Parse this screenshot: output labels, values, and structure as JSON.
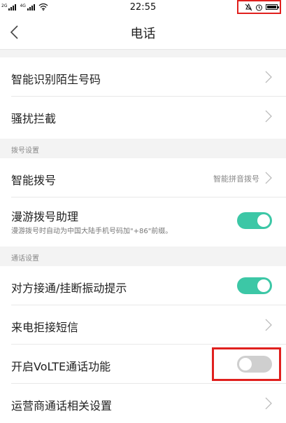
{
  "status_bar": {
    "sim1_tag": "2G",
    "sim2_tag": "4G",
    "time": "22:55",
    "icons": [
      "signal-icon",
      "signal-icon",
      "wifi-icon",
      "mute-icon",
      "alarm-icon",
      "battery-icon"
    ]
  },
  "header": {
    "title": "电话",
    "back_icon": "chevron-left-icon"
  },
  "sections": {
    "top": {
      "items": [
        {
          "label": "智能识别陌生号码"
        },
        {
          "label": "骚扰拦截"
        }
      ]
    },
    "dial_settings": {
      "header": "拨号设置",
      "smart_dial": {
        "label": "智能拨号",
        "value": "智能拼音拨号"
      },
      "roaming": {
        "label": "漫游拨号助理",
        "sub": "漫游拨号时自动为中国大陆手机号码加\"+86\"前缀。",
        "toggle": "on"
      }
    },
    "call_settings": {
      "header": "通话设置",
      "vibrate": {
        "label": "对方接通/挂断振动提示",
        "toggle": "on"
      },
      "reject_sms": {
        "label": "来电拒接短信"
      },
      "volte": {
        "label": "开启VoLTE通话功能",
        "toggle": "off"
      },
      "carrier": {
        "label": "运营商通话相关设置"
      }
    }
  },
  "colors": {
    "toggle_on": "#3cc7a6",
    "toggle_off": "#cfcfcf",
    "highlight": "#e0201e",
    "section_bg": "#f3f3f3"
  }
}
